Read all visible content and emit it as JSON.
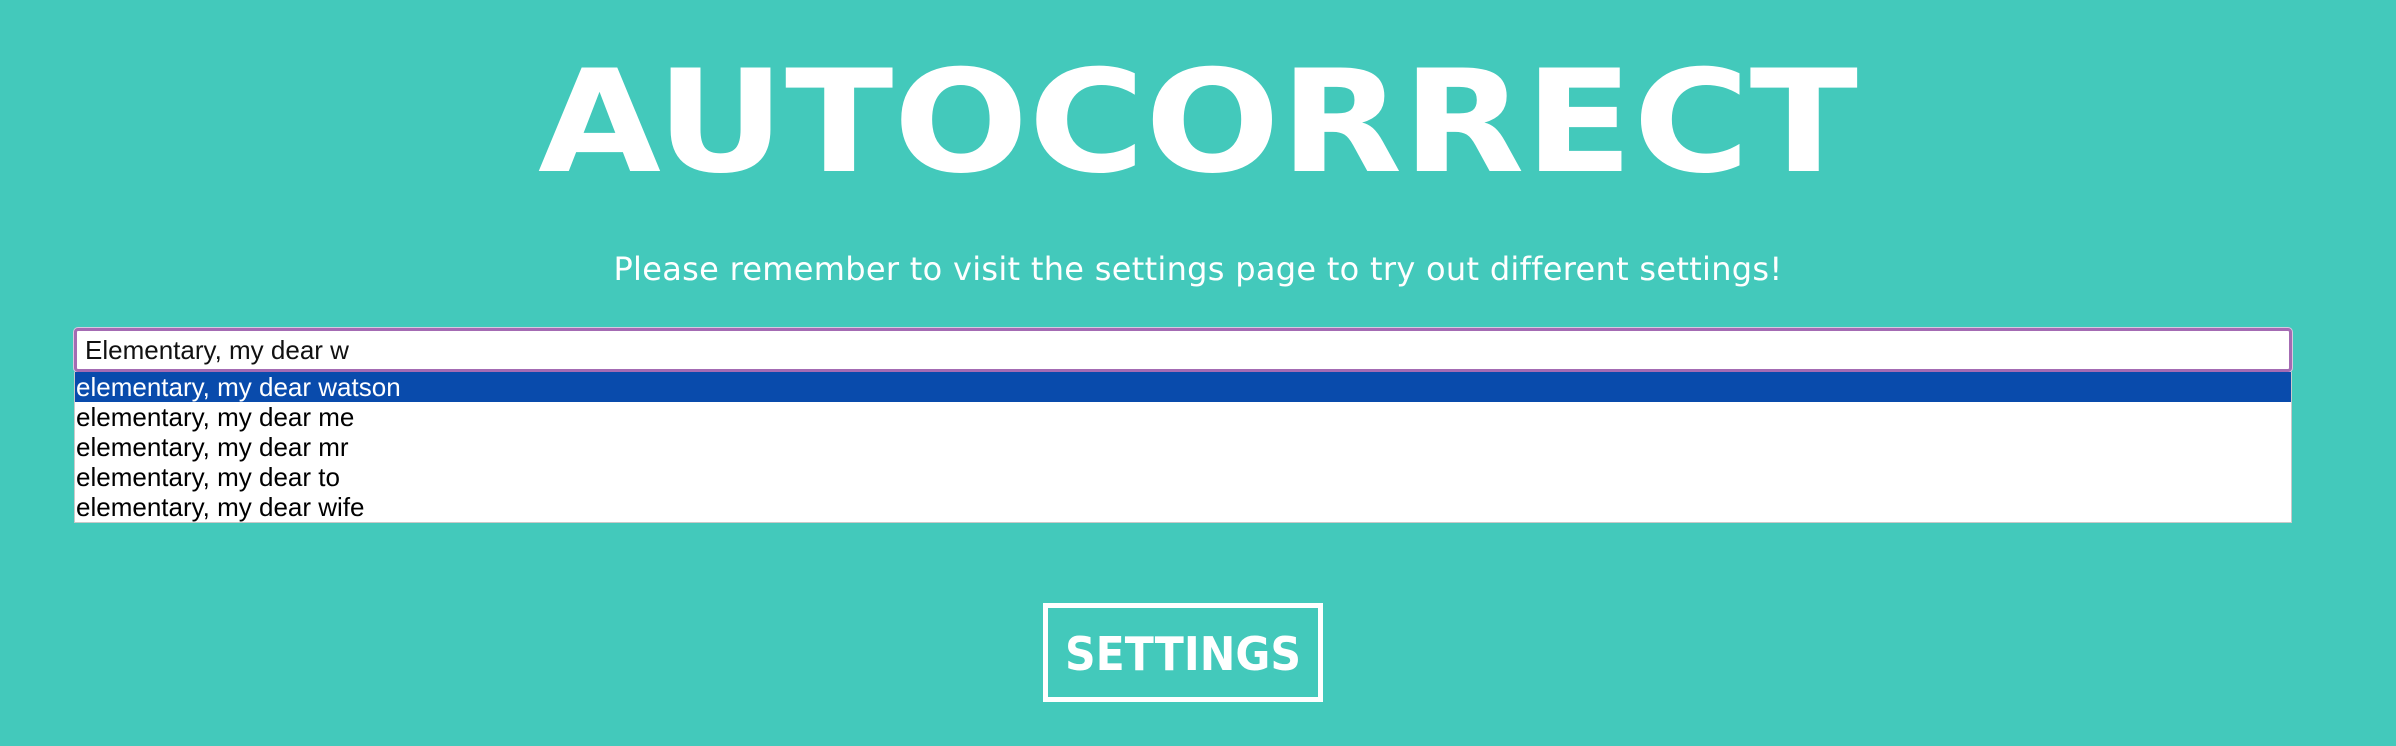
{
  "header": {
    "title": "AUTOCORRECT",
    "subtitle": "Please remember to visit the settings page to try out different settings!"
  },
  "search": {
    "value": "Elementary, my dear w",
    "placeholder": ""
  },
  "suggestions": {
    "items": [
      "elementary, my dear watson",
      "elementary, my dear me",
      "elementary, my dear mr",
      "elementary, my dear to",
      "elementary, my dear wife"
    ],
    "highlighted_index": 0
  },
  "footer": {
    "settings_label": "SETTINGS"
  },
  "colors": {
    "background": "#43c9bb",
    "text": "#ffffff",
    "input_border": "#a46bb3",
    "highlight": "#094bac"
  }
}
